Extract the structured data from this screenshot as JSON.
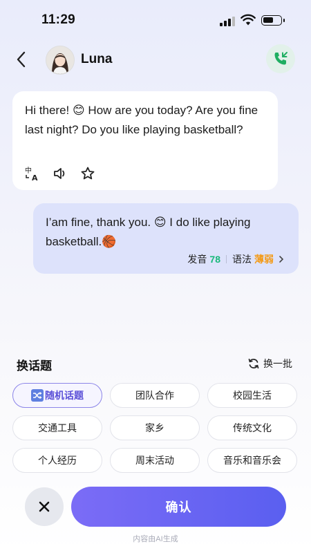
{
  "status": {
    "time": "11:29"
  },
  "header": {
    "name": "Luna"
  },
  "messages": {
    "incoming": "Hi there! 😊 How are you today? Are you fine last night? Do you like playing basketball?",
    "outgoing": "I’am fine,  thank you. 😊 I do like playing basketball.🏀",
    "pronunciation_label": "发音",
    "pronunciation_score": "78",
    "grammar_label": "语法",
    "grammar_level": "薄弱"
  },
  "topics": {
    "title": "换话题",
    "refresh_label": "换一批",
    "items": [
      "随机话题",
      "团队合作",
      "校园生活",
      "交通工具",
      "家乡",
      "传统文化",
      "个人经历",
      "周末活动",
      "音乐和音乐会"
    ]
  },
  "footer": {
    "confirm_label": "确认",
    "ai_note": "内容由AI生成"
  },
  "colors": {
    "accent": "#6b66f3",
    "call_green": "#1fae62",
    "score_green": "#18b87a",
    "weak_orange": "#f39b19"
  }
}
